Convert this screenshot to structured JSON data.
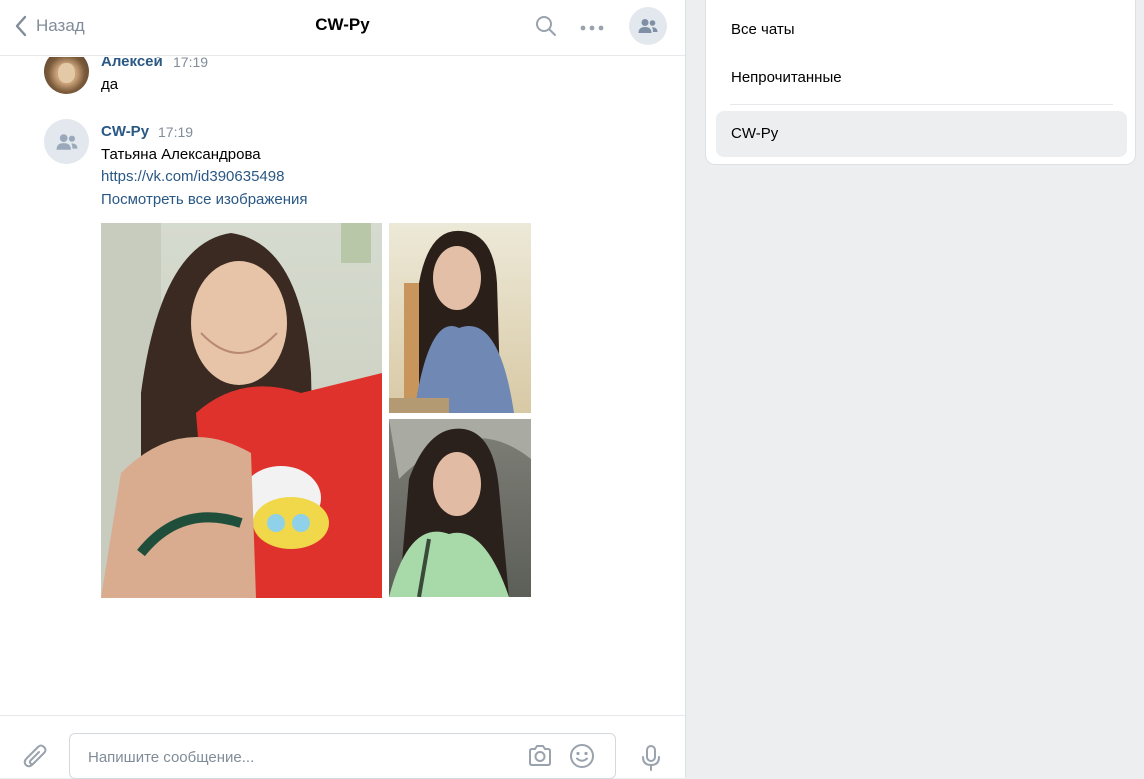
{
  "header": {
    "back_label": "Назад",
    "title": "CW-Ру",
    "icons": [
      "chevron-left-icon",
      "search-icon",
      "more-icon",
      "group-icon"
    ]
  },
  "messages": [
    {
      "author": "Алексей",
      "time": "17:19",
      "text": "да",
      "avatar": "lion-avatar"
    },
    {
      "author": "CW-Ру",
      "time": "17:19",
      "text": "Татьяна Александрова",
      "link": "https://vk.com/id390635498",
      "view_all": "Посмотреть все изображения",
      "avatar": "group-avatar",
      "photos": 3
    }
  ],
  "composer": {
    "placeholder": "Напишите сообщение...",
    "icons": [
      "paperclip-icon",
      "camera-icon",
      "smile-icon",
      "microphone-icon"
    ]
  },
  "folders": {
    "items": [
      {
        "label": "Все чаты",
        "active": false
      },
      {
        "label": "Непрочитанные",
        "active": false
      },
      {
        "label": "CW-Ру",
        "active": true
      }
    ]
  },
  "colors": {
    "link": "#2a5885",
    "muted": "#818c99",
    "background": "#edeef0",
    "accent_avatar": "#e3e8ef"
  }
}
